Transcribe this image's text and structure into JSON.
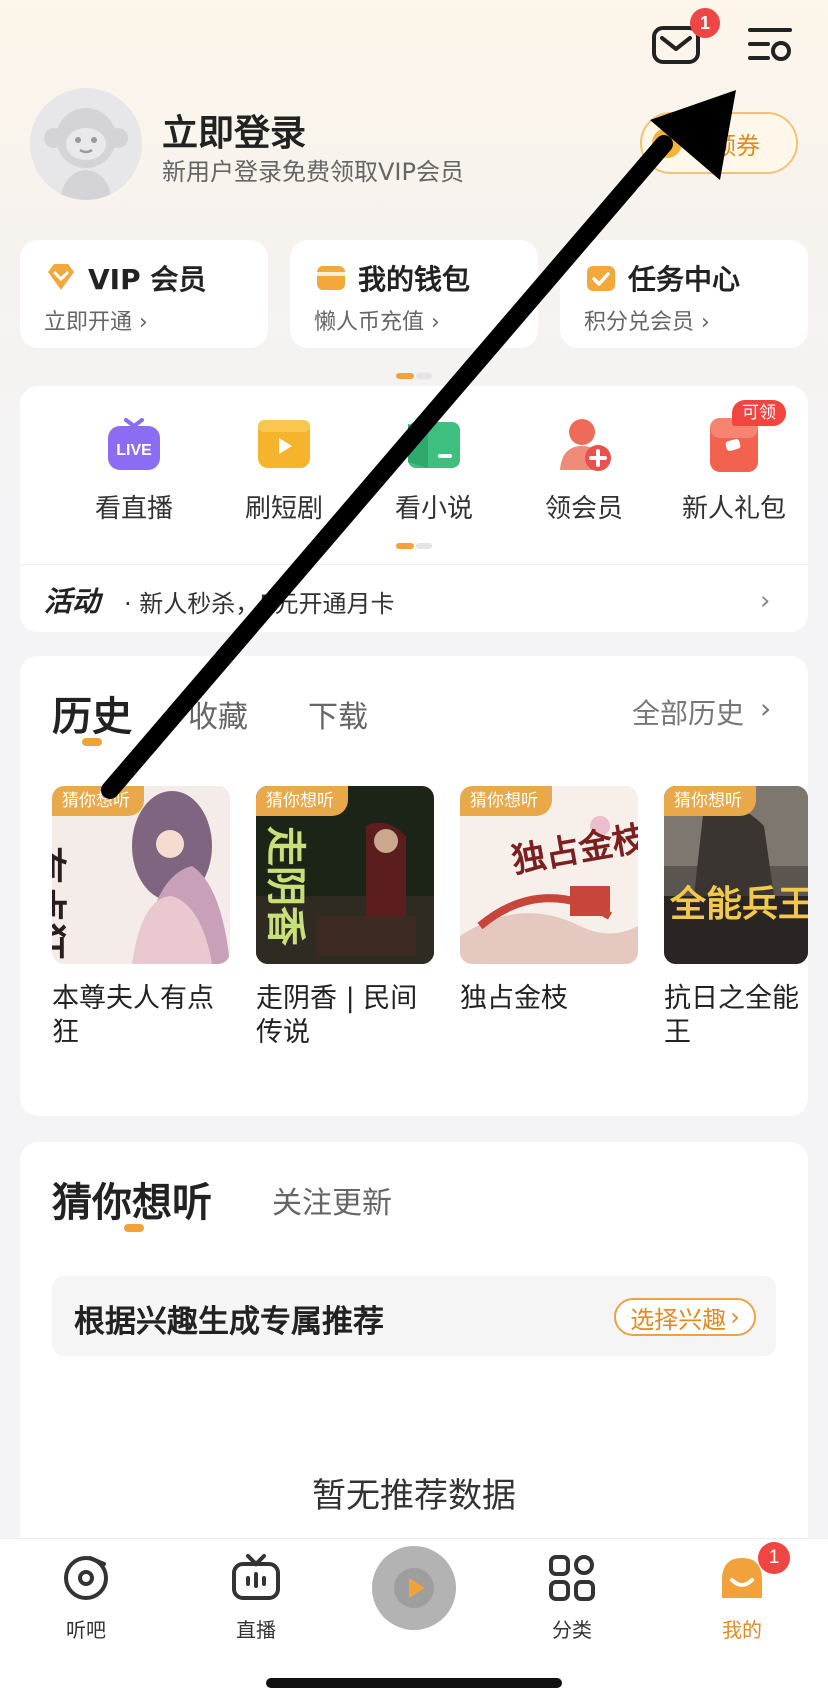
{
  "header": {
    "mail_badge": "1"
  },
  "profile": {
    "title": "立即登录",
    "subtitle": "新用户登录免费领取VIP会员",
    "checkin_label": "到领券"
  },
  "quick_cards": [
    {
      "title": "VIP 会员",
      "sub": "立即开通 ›"
    },
    {
      "title": "我的钱包",
      "sub": "懒人币充值 ›"
    },
    {
      "title": "任务中心",
      "sub": "积分兑会员 ›"
    }
  ],
  "features": {
    "items": [
      {
        "label": "看直播",
        "icon_text": "LIVE"
      },
      {
        "label": "刷短剧"
      },
      {
        "label": "看小说"
      },
      {
        "label": "领会员"
      },
      {
        "label": "新人礼包"
      }
    ],
    "new_tag": "可领"
  },
  "activity": {
    "tag": "活动",
    "text": "· 新人秒杀，5元开通月卡"
  },
  "history": {
    "tabs": [
      "历史",
      "收藏",
      "下载"
    ],
    "all_label": "全部历史",
    "cover_tag": "猜你想听",
    "books": [
      {
        "title": "本尊夫人有点狂",
        "cover_text": "有点狂"
      },
      {
        "title": "走阴香 | 民间传说",
        "cover_text": "走阴香"
      },
      {
        "title": "独占金枝",
        "cover_text": "独占金枝"
      },
      {
        "title": "抗日之全能王",
        "cover_text": "全能兵王"
      }
    ]
  },
  "recommend": {
    "tabs": [
      "猜你想听",
      "关注更新"
    ],
    "interest_text": "根据兴趣生成专属推荐",
    "interest_button": "选择兴趣",
    "empty_text": "暂无推荐数据"
  },
  "bottom_nav": {
    "items": [
      "听吧",
      "直播",
      "分类",
      "我的"
    ],
    "badge": "1"
  },
  "colors": {
    "accent": "#f2a23a",
    "badge": "#f04545",
    "brand_orange": "#e38b22"
  }
}
